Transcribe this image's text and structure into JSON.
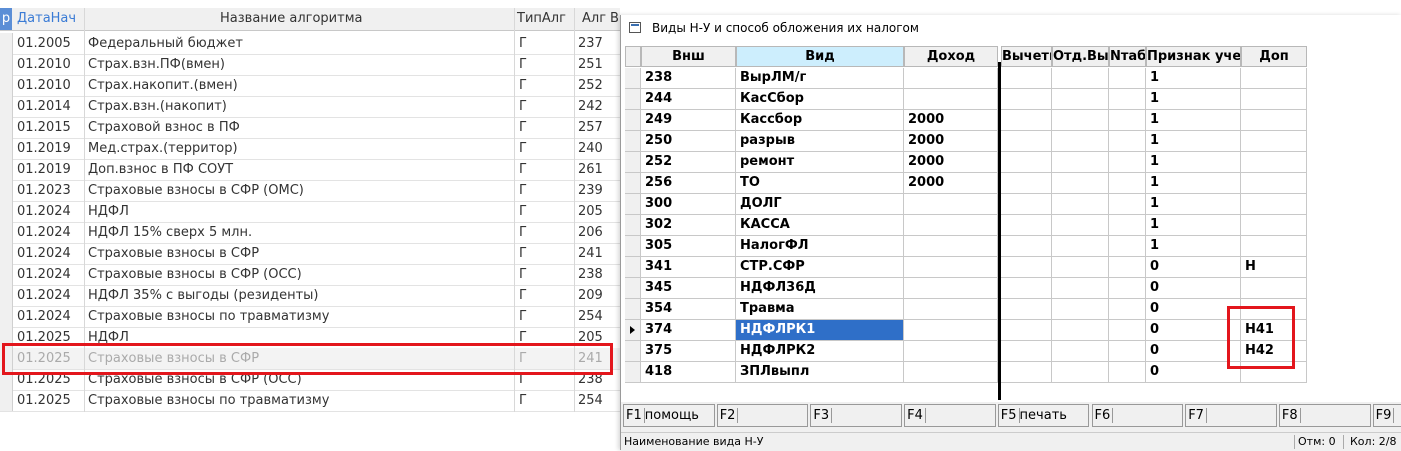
{
  "background_table": {
    "headers": {
      "marker": "р",
      "date": "ДатаНач",
      "name": "Название алгоритма",
      "type": "ТипАлг",
      "alg": "Алг",
      "extra": "В"
    },
    "rows": [
      {
        "date": "01.2005",
        "name": "Федеральный бюджет",
        "type": "Г",
        "alg": "237"
      },
      {
        "date": "01.2010",
        "name": "Страх.взн.ПФ(вмен)",
        "type": "Г",
        "alg": "251"
      },
      {
        "date": "01.2010",
        "name": "Страх.накопит.(вмен)",
        "type": "Г",
        "alg": "252"
      },
      {
        "date": "01.2014",
        "name": "Страх.взн.(накопит)",
        "type": "Г",
        "alg": "242"
      },
      {
        "date": "01.2015",
        "name": "Страховой взнос в ПФ",
        "type": "Г",
        "alg": "257"
      },
      {
        "date": "01.2019",
        "name": "Мед.страх.(территор)",
        "type": "Г",
        "alg": "240"
      },
      {
        "date": "01.2019",
        "name": "Доп.взнос в ПФ СОУТ",
        "type": "Г",
        "alg": "261"
      },
      {
        "date": "01.2023",
        "name": "Страховые взносы в СФР (ОМС)",
        "type": "Г",
        "alg": "239"
      },
      {
        "date": "01.2024",
        "name": "НДФЛ",
        "type": "Г",
        "alg": "205"
      },
      {
        "date": "01.2024",
        "name": "НДФЛ 15% сверх 5 млн.",
        "type": "Г",
        "alg": "206"
      },
      {
        "date": "01.2024",
        "name": "Страховые взносы в СФР",
        "type": "Г",
        "alg": "241"
      },
      {
        "date": "01.2024",
        "name": "Страховые взносы в СФР (ОСС)",
        "type": "Г",
        "alg": "238"
      },
      {
        "date": "01.2024",
        "name": "НДФЛ 35% с выгоды (резиденты)",
        "type": "Г",
        "alg": "209"
      },
      {
        "date": "01.2024",
        "name": "Страховые взносы по травматизму",
        "type": "Г",
        "alg": "254"
      },
      {
        "date": "01.2025",
        "name": "НДФЛ",
        "type": "Г",
        "alg": "205"
      },
      {
        "date": "01.2025",
        "name": "Страховые взносы в СФР",
        "type": "Г",
        "alg": "241"
      },
      {
        "date": "01.2025",
        "name": "Страховые взносы в СФР (ОСС)",
        "type": "Г",
        "alg": "238"
      },
      {
        "date": "01.2025",
        "name": "Страховые взносы по травматизму",
        "type": "Г",
        "alg": "254"
      }
    ]
  },
  "dialog": {
    "title": "Виды Н-У и способ обложения их налогом",
    "columns": [
      "Внш",
      "Вид",
      "Доход",
      "Вычеты",
      "Отд.Выч",
      "Nтаб",
      "Признак учет",
      "Доп"
    ],
    "rows": [
      {
        "vnsh": "238",
        "vid": "ВырЛМ/г",
        "dohod": "",
        "vychety": "",
        "otd": "",
        "ntab": "",
        "priznak": "1",
        "dop": ""
      },
      {
        "vnsh": "244",
        "vid": "КасСбор",
        "dohod": "",
        "vychety": "",
        "otd": "",
        "ntab": "",
        "priznak": "1",
        "dop": ""
      },
      {
        "vnsh": "249",
        "vid": "Кассбор",
        "dohod": "2000",
        "vychety": "",
        "otd": "",
        "ntab": "",
        "priznak": "1",
        "dop": ""
      },
      {
        "vnsh": "250",
        "vid": "разрыв",
        "dohod": "2000",
        "vychety": "",
        "otd": "",
        "ntab": "",
        "priznak": "1",
        "dop": ""
      },
      {
        "vnsh": "252",
        "vid": "ремонт",
        "dohod": "2000",
        "vychety": "",
        "otd": "",
        "ntab": "",
        "priznak": "1",
        "dop": ""
      },
      {
        "vnsh": "256",
        "vid": "ТО",
        "dohod": "2000",
        "vychety": "",
        "otd": "",
        "ntab": "",
        "priznak": "1",
        "dop": ""
      },
      {
        "vnsh": "300",
        "vid": "ДОЛГ",
        "dohod": "",
        "vychety": "",
        "otd": "",
        "ntab": "",
        "priznak": "1",
        "dop": ""
      },
      {
        "vnsh": "302",
        "vid": "КАССА",
        "dohod": "",
        "vychety": "",
        "otd": "",
        "ntab": "",
        "priznak": "1",
        "dop": ""
      },
      {
        "vnsh": "305",
        "vid": "НалогФЛ",
        "dohod": "",
        "vychety": "",
        "otd": "",
        "ntab": "",
        "priznak": "1",
        "dop": ""
      },
      {
        "vnsh": "341",
        "vid": "СТР.СФР",
        "dohod": "",
        "vychety": "",
        "otd": "",
        "ntab": "",
        "priznak": "0",
        "dop": "Н"
      },
      {
        "vnsh": "345",
        "vid": "НДФЛ36Д",
        "dohod": "",
        "vychety": "",
        "otd": "",
        "ntab": "",
        "priznak": "0",
        "dop": ""
      },
      {
        "vnsh": "354",
        "vid": "Травма",
        "dohod": "",
        "vychety": "",
        "otd": "",
        "ntab": "",
        "priznak": "0",
        "dop": ""
      },
      {
        "vnsh": "374",
        "vid": "НДФЛРК1",
        "dohod": "",
        "vychety": "",
        "otd": "",
        "ntab": "",
        "priznak": "0",
        "dop": "Н41"
      },
      {
        "vnsh": "375",
        "vid": "НДФЛРК2",
        "dohod": "",
        "vychety": "",
        "otd": "",
        "ntab": "",
        "priznak": "0",
        "dop": "Н42"
      },
      {
        "vnsh": "418",
        "vid": "ЗПЛвыпл",
        "dohod": "",
        "vychety": "",
        "otd": "",
        "ntab": "",
        "priznak": "0",
        "dop": ""
      }
    ],
    "fkeys": [
      {
        "key": "F1",
        "label": "помощь"
      },
      {
        "key": "F2",
        "label": ""
      },
      {
        "key": "F3",
        "label": ""
      },
      {
        "key": "F4",
        "label": ""
      },
      {
        "key": "F5",
        "label": "печать"
      },
      {
        "key": "F6",
        "label": ""
      },
      {
        "key": "F7",
        "label": ""
      },
      {
        "key": "F8",
        "label": ""
      },
      {
        "key": "F9",
        "label": ""
      }
    ],
    "status": {
      "hint": "Наименование вида Н-У",
      "otm": "Отм: 0",
      "kol": "Кол: 2/8"
    }
  },
  "colors": {
    "highlight": "#2f6fc8",
    "annotation_red": "#e3161c",
    "header_active": "#cdeefd"
  }
}
